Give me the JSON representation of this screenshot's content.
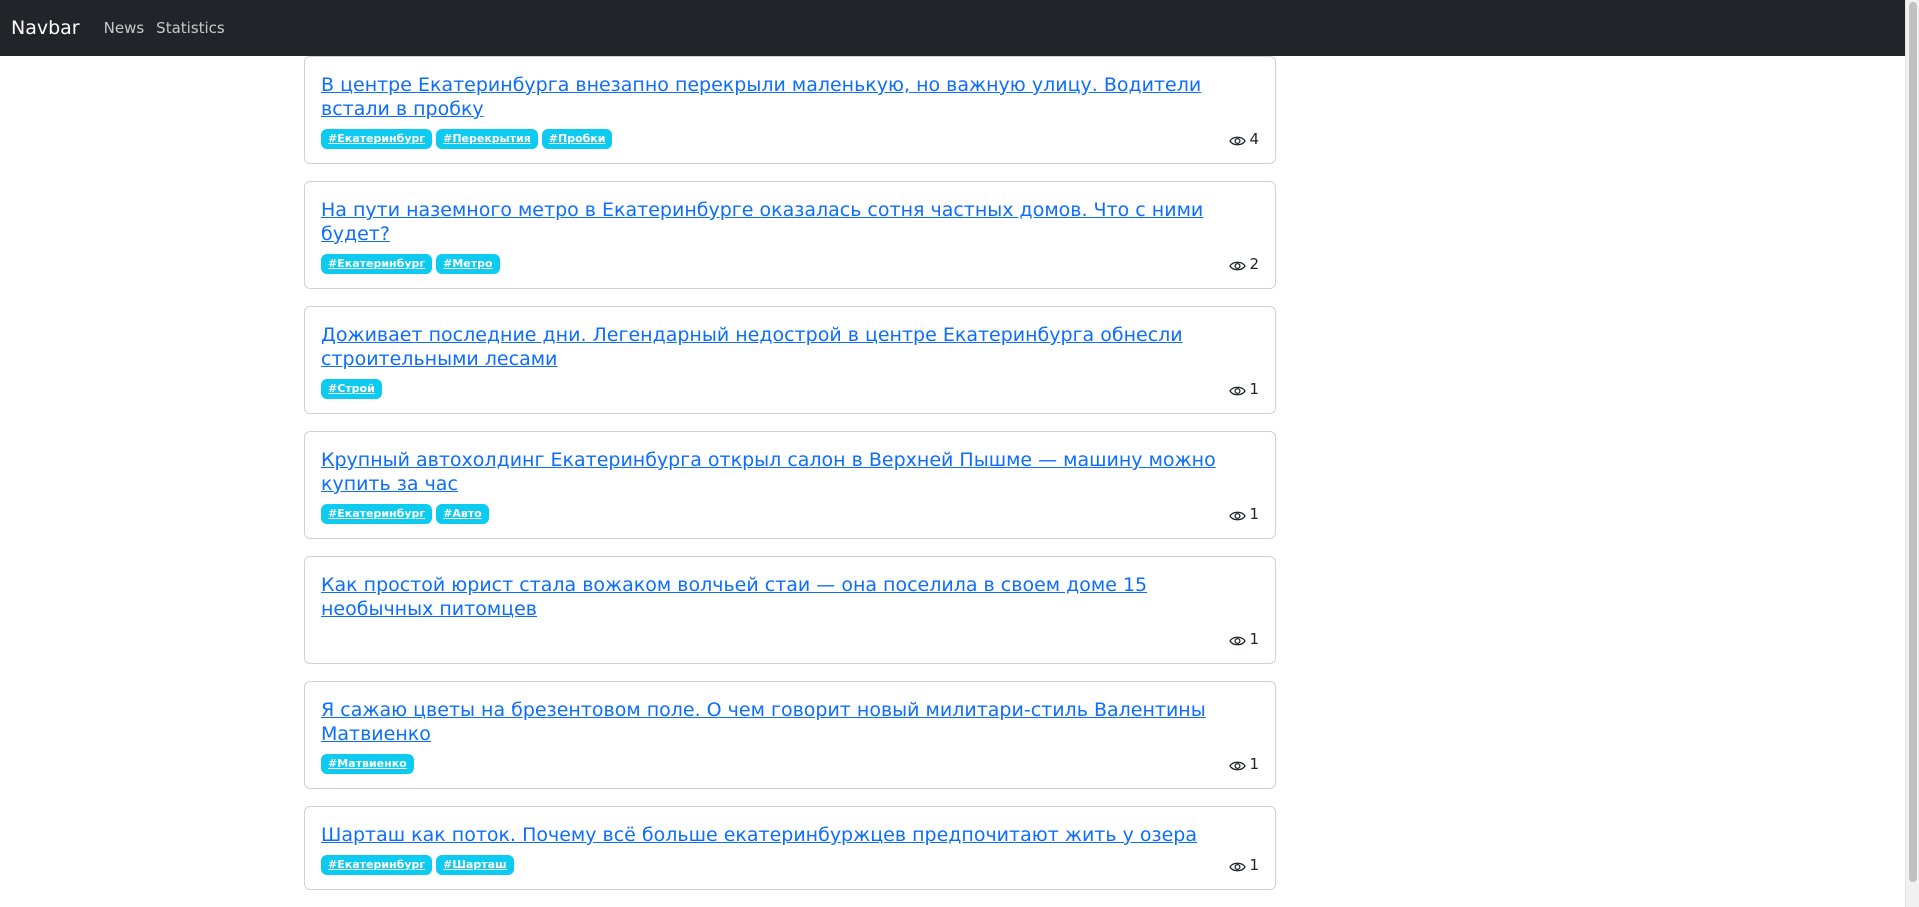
{
  "navbar": {
    "brand": "Navbar",
    "links": [
      "News",
      "Statistics"
    ]
  },
  "news": [
    {
      "title": "В центре Екатеринбурга внезапно перекрыли маленькую, но важную улицу. Водители встали в пробку",
      "tags": [
        "#Екатеринбург",
        "#Перекрытия",
        "#Пробки"
      ],
      "views": "4"
    },
    {
      "title": "На пути наземного метро в Екатеринбурге оказалась сотня частных домов. Что с ними будет?",
      "tags": [
        "#Екатеринбург",
        "#Метро"
      ],
      "views": "2"
    },
    {
      "title": "Доживает последние дни. Легендарный недострой в центре Екатеринбурга обнесли строительными лесами",
      "tags": [
        "#Строй"
      ],
      "views": "1"
    },
    {
      "title": "Крупный автохолдинг Екатеринбурга открыл салон в Верхней Пышме — машину можно купить за час",
      "tags": [
        "#Екатеринбург",
        "#Авто"
      ],
      "views": "1"
    },
    {
      "title": "Как простой юрист стала вожаком волчьей стаи — она поселила в своем доме 15 необычных питомцев",
      "tags": [],
      "views": "1"
    },
    {
      "title": "Я сажаю цветы на брезентовом поле. О чем говорит новый милитари-стиль Валентины Матвиенко",
      "tags": [
        "#Матвиенко"
      ],
      "views": "1"
    },
    {
      "title": "Шарташ как поток. Почему всё больше екатеринбуржцев предпочитают жить у озера",
      "tags": [
        "#Екатеринбург",
        "#Шарташ"
      ],
      "views": "1"
    }
  ],
  "icons": {
    "views": "eye-icon"
  },
  "colors": {
    "navbar_bg": "#212529",
    "link": "#0d6efd",
    "tag_bg": "#0dcaf0"
  }
}
